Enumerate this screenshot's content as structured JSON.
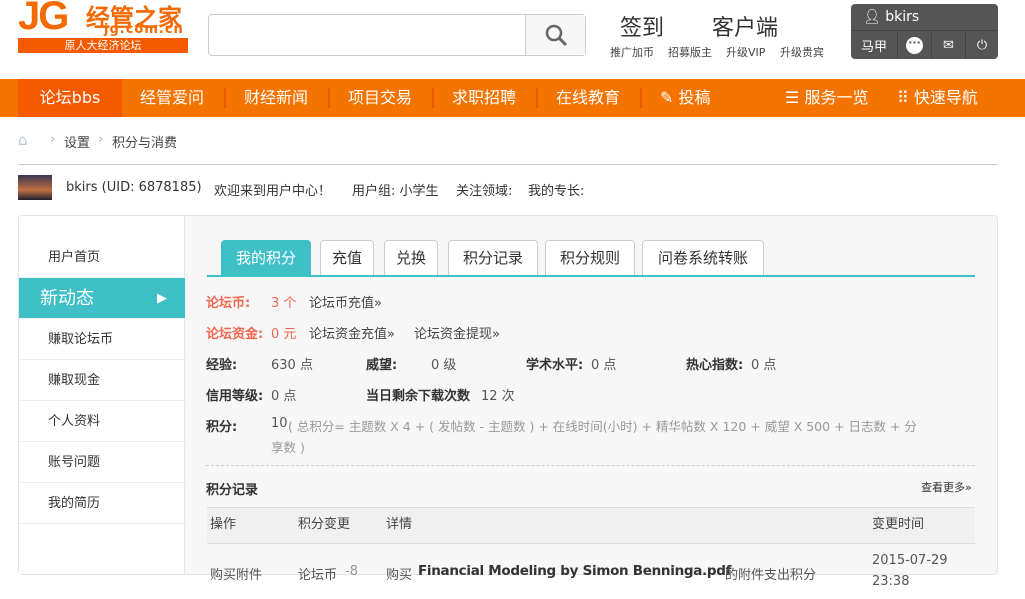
{
  "header": {
    "logo_mark": "JG",
    "logo_name": "经管之家",
    "logo_domain": "jg.com.cn",
    "logo_tagline": "原人大经济论坛",
    "search_placeholder": "",
    "checkin": "签到",
    "client": "客户端",
    "sub_links": [
      "推广加币",
      "招募版主",
      "升级VIP",
      "升级贵宾"
    ]
  },
  "user_box": {
    "username": "bkirs",
    "majia": "马甲"
  },
  "nav": {
    "items": [
      "论坛bbs",
      "经管爱问",
      "财经新闻",
      "项目交易",
      "求职招聘",
      "在线教育",
      "投稿"
    ],
    "right": [
      "服务一览",
      "快速导航"
    ]
  },
  "breadcrumb": [
    "设置",
    "积分与消费"
  ],
  "profile": {
    "name": "bkirs (UID: 6878185)",
    "welcome": "欢迎来到用户中心！",
    "group": "用户组: 小学生",
    "focus": "关注领域:",
    "expertise": "我的专长:"
  },
  "sidebar": {
    "items": [
      "用户首页",
      "新动态",
      "赚取论坛币",
      "赚取现金",
      "个人资料",
      "账号问题",
      "我的简历"
    ]
  },
  "tabs": [
    "我的积分",
    "充值",
    "兑换",
    "积分记录",
    "积分规则",
    "问卷系统转账"
  ],
  "points": {
    "coin_label": "论坛币:",
    "coin_value": "3 个",
    "coin_link": "论坛币充值»",
    "fund_label": "论坛资金:",
    "fund_value": "0 元",
    "fund_link1": "论坛资金充值»",
    "fund_link2": "论坛资金提现»",
    "exp_label": "经验:",
    "exp_value": "630 点",
    "prestige_label": "威望:",
    "prestige_value": "0 级",
    "academic_label": "学术水平:",
    "academic_value": "0 点",
    "enthusiasm_label": "热心指数:",
    "enthusiasm_value": "0 点",
    "credit_label": "信用等级:",
    "credit_value": "0 点",
    "downloads_label": "当日剩余下载次数",
    "downloads_value": "12 次",
    "score_label": "积分:",
    "score_value": "10",
    "score_formula": "( 总积分= 主题数 X 4 + ( 发帖数 - 主题数 ) + 在线时间(小时) + 精华帖数 X 120 + 威望 X 500 + 日志数 + 分",
    "score_formula2": "享数 )"
  },
  "log": {
    "title": "积分记录",
    "more": "查看更多»",
    "headers": [
      "操作",
      "积分变更",
      "详情",
      "变更时间"
    ],
    "rows": [
      {
        "action": "购买附件",
        "change_type": "论坛币",
        "change_amount": "-8",
        "detail_prefix": "购买",
        "detail_file": "Financial Modeling by Simon Benninga.pdf",
        "detail_suffix": "的附件支出积分",
        "date": "2015-07-29",
        "time": "23:38"
      }
    ]
  },
  "colors": {
    "orange": "#f57300",
    "teal": "#3fc0c6",
    "red": "#f0684f"
  }
}
